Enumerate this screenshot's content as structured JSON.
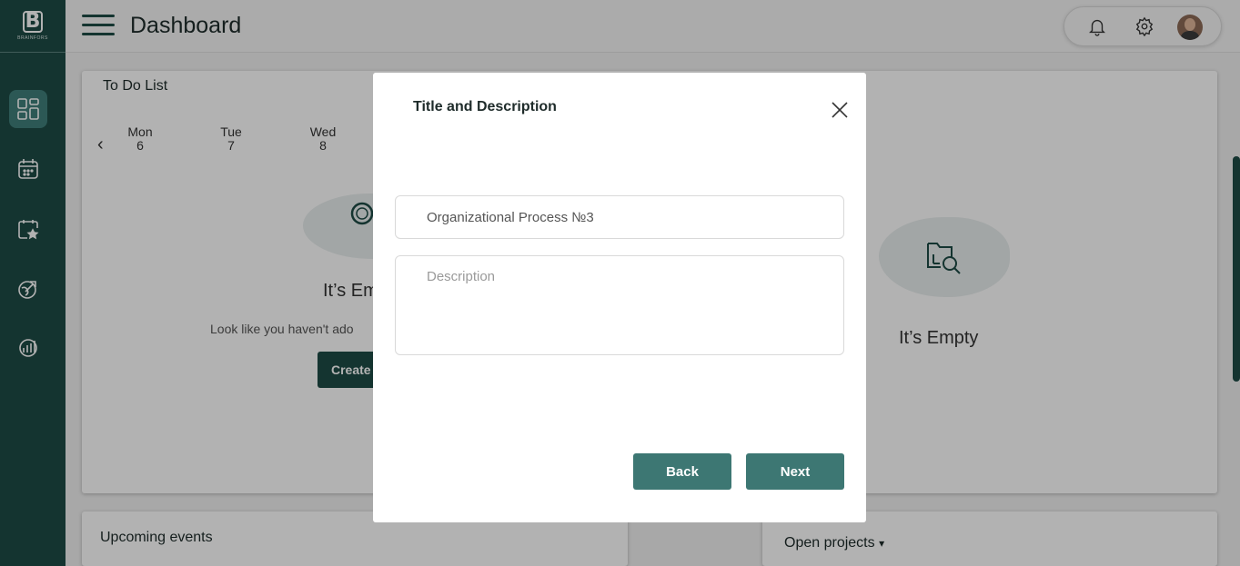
{
  "app": {
    "logo_letter": "B",
    "logo_text": "BRAINFORS"
  },
  "header": {
    "title": "Dashboard"
  },
  "sidebar": {
    "items": [
      {
        "name": "dashboard",
        "icon": "dashboard-icon",
        "active": true
      },
      {
        "name": "calendar",
        "icon": "calendar-icon",
        "active": false
      },
      {
        "name": "favorites",
        "icon": "calendar-star-icon",
        "active": false
      },
      {
        "name": "rocket",
        "icon": "rocket-icon",
        "active": false
      },
      {
        "name": "analytics",
        "icon": "chart-icon",
        "active": false
      }
    ]
  },
  "todo": {
    "title": "To Do List",
    "days": [
      {
        "name": "Mon",
        "num": "6"
      },
      {
        "name": "Tue",
        "num": "7"
      },
      {
        "name": "Wed",
        "num": "8"
      }
    ],
    "empty_title": "It’s Em",
    "empty_sub": "Look like you haven't ado",
    "create_label": "Create"
  },
  "right_panel": {
    "empty_title": "It’s Empty"
  },
  "upcoming": {
    "title": "Upcoming events"
  },
  "projects": {
    "title": "Open projects",
    "caret": "▾"
  },
  "modal": {
    "title": "Title and Description",
    "name_value": "Organizational Process №3",
    "description_placeholder": "Description",
    "back_label": "Back",
    "next_label": "Next"
  },
  "colors": {
    "primary": "#1e4b45",
    "button": "#3d7773",
    "active_side": "#3f7e7a"
  }
}
